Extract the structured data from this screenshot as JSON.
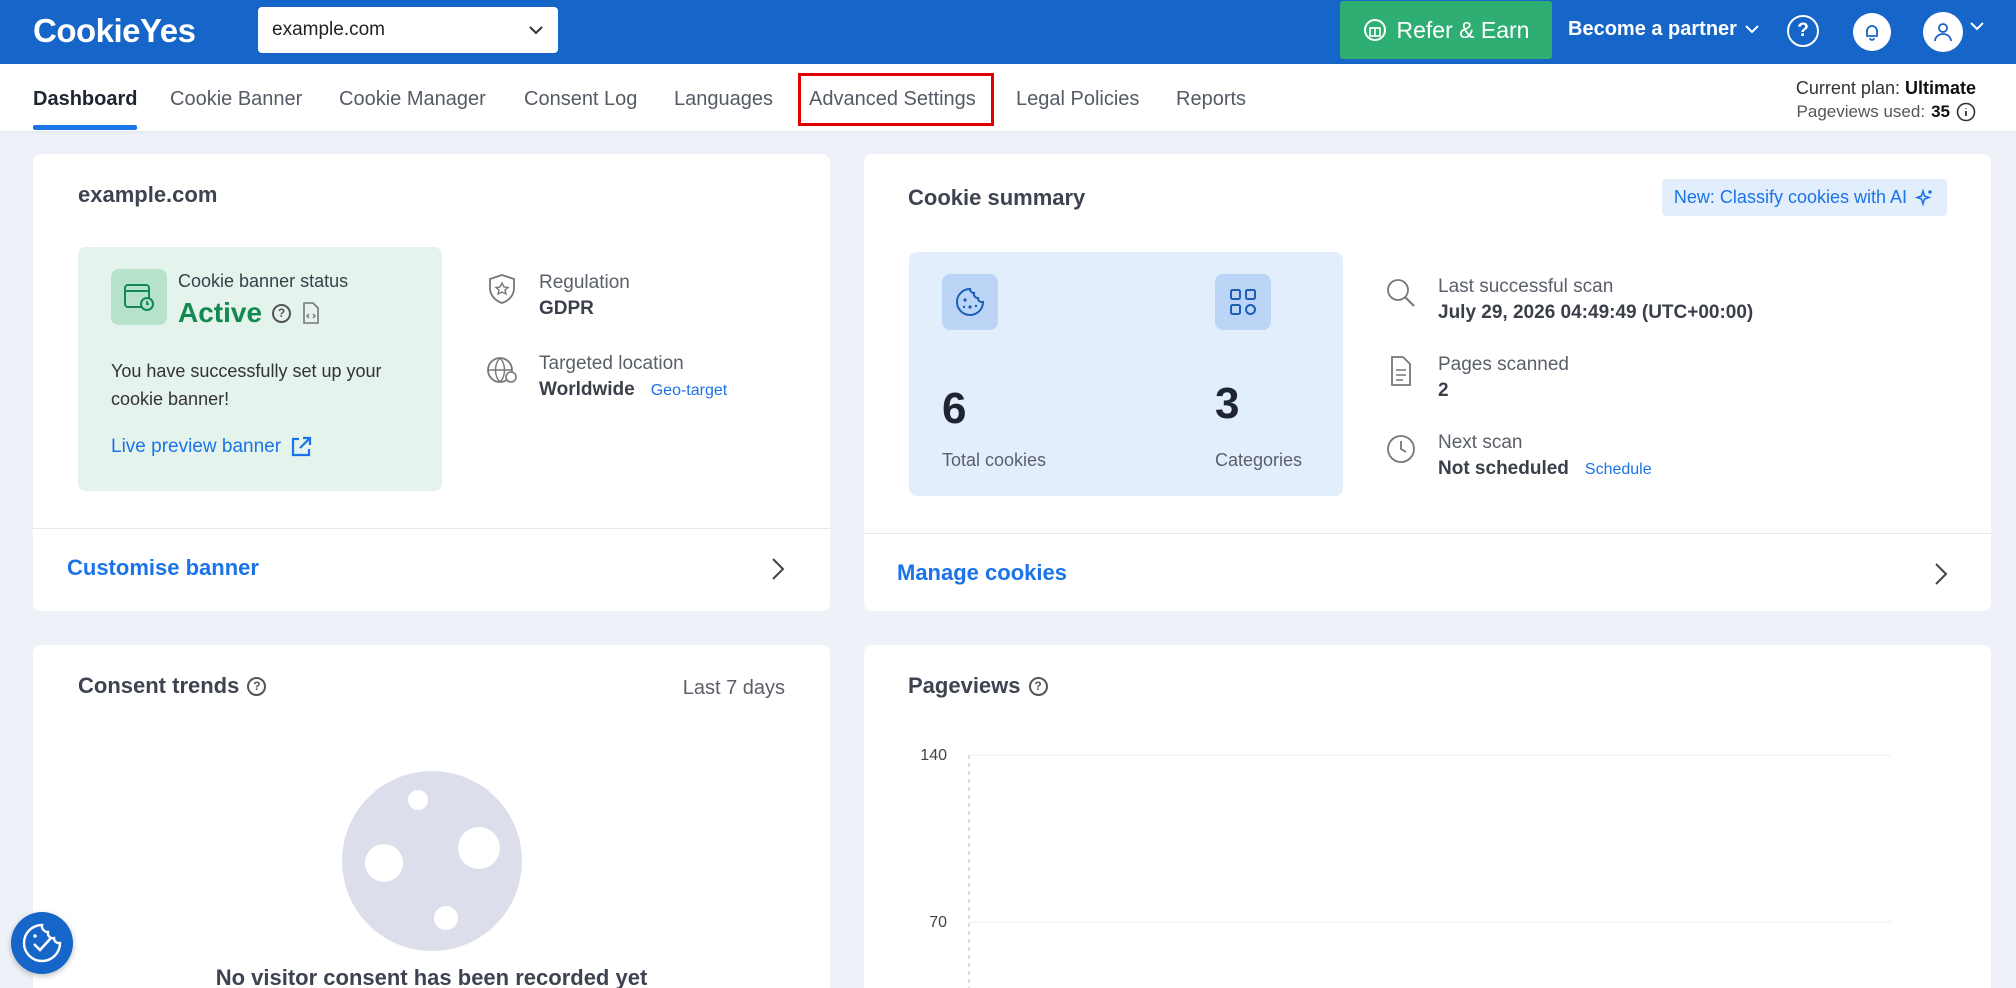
{
  "header": {
    "logo_text": "CookieYes",
    "site_select": {
      "value": "example.com"
    },
    "refer_label": "Refer & Earn",
    "partner_label": "Become a partner",
    "help_label": "?"
  },
  "nav": {
    "tabs": [
      {
        "label": "Dashboard",
        "active": true
      },
      {
        "label": "Cookie Banner"
      },
      {
        "label": "Cookie Manager"
      },
      {
        "label": "Consent Log"
      },
      {
        "label": "Languages"
      },
      {
        "label": "Advanced Settings",
        "highlighted": true
      },
      {
        "label": "Legal Policies"
      },
      {
        "label": "Reports"
      }
    ],
    "plan": {
      "label": "Current plan:",
      "value": "Ultimate",
      "pageviews_label": "Pageviews used:",
      "pageviews_value": "35"
    }
  },
  "banner_card": {
    "title": "example.com",
    "status_label": "Cookie banner status",
    "status_value": "Active",
    "message": "You have successfully set up your cookie banner!",
    "preview_link": "Live preview banner",
    "regulation_label": "Regulation",
    "regulation_value": "GDPR",
    "location_label": "Targeted location",
    "location_value": "Worldwide",
    "geo_link": "Geo-target",
    "footer_link": "Customise banner"
  },
  "summary_card": {
    "title": "Cookie summary",
    "ai_badge": "New: Classify cookies with AI",
    "total_cookies": "6",
    "total_label": "Total cookies",
    "categories": "3",
    "categories_label": "Categories",
    "last_scan_label": "Last successful scan",
    "last_scan_value": "July 29, 2026 04:49:49 (UTC+00:00)",
    "pages_label": "Pages scanned",
    "pages_value": "2",
    "next_label": "Next scan",
    "next_value": "Not scheduled",
    "schedule_link": "Schedule",
    "footer_link": "Manage cookies"
  },
  "trends_card": {
    "title": "Consent trends",
    "range": "Last 7 days",
    "empty_message": "No visitor consent has been recorded yet"
  },
  "pageviews_card": {
    "title": "Pageviews",
    "chart_data": {
      "type": "line",
      "y_ticks": [
        "140",
        "70"
      ],
      "ylim": [
        0,
        140
      ],
      "series": [],
      "grid": true
    }
  },
  "colors": {
    "brand": "#1665c9",
    "accent_green": "#2fae74",
    "active_green": "#13894f",
    "link_blue": "#1a73e8",
    "highlight_red": "#e00000"
  },
  "icons": {
    "refer": "gift-icon",
    "help": "question-circle-icon",
    "bell": "bell-icon",
    "avatar": "user-icon",
    "status": "browser-clock-icon",
    "regulation": "shield-star-icon",
    "location": "globe-pin-icon",
    "cookie": "cookie-icon",
    "categories": "grid-icon",
    "scan": "search-icon",
    "pages": "document-icon",
    "next": "clock-icon",
    "fab": "cookie-check-icon"
  }
}
